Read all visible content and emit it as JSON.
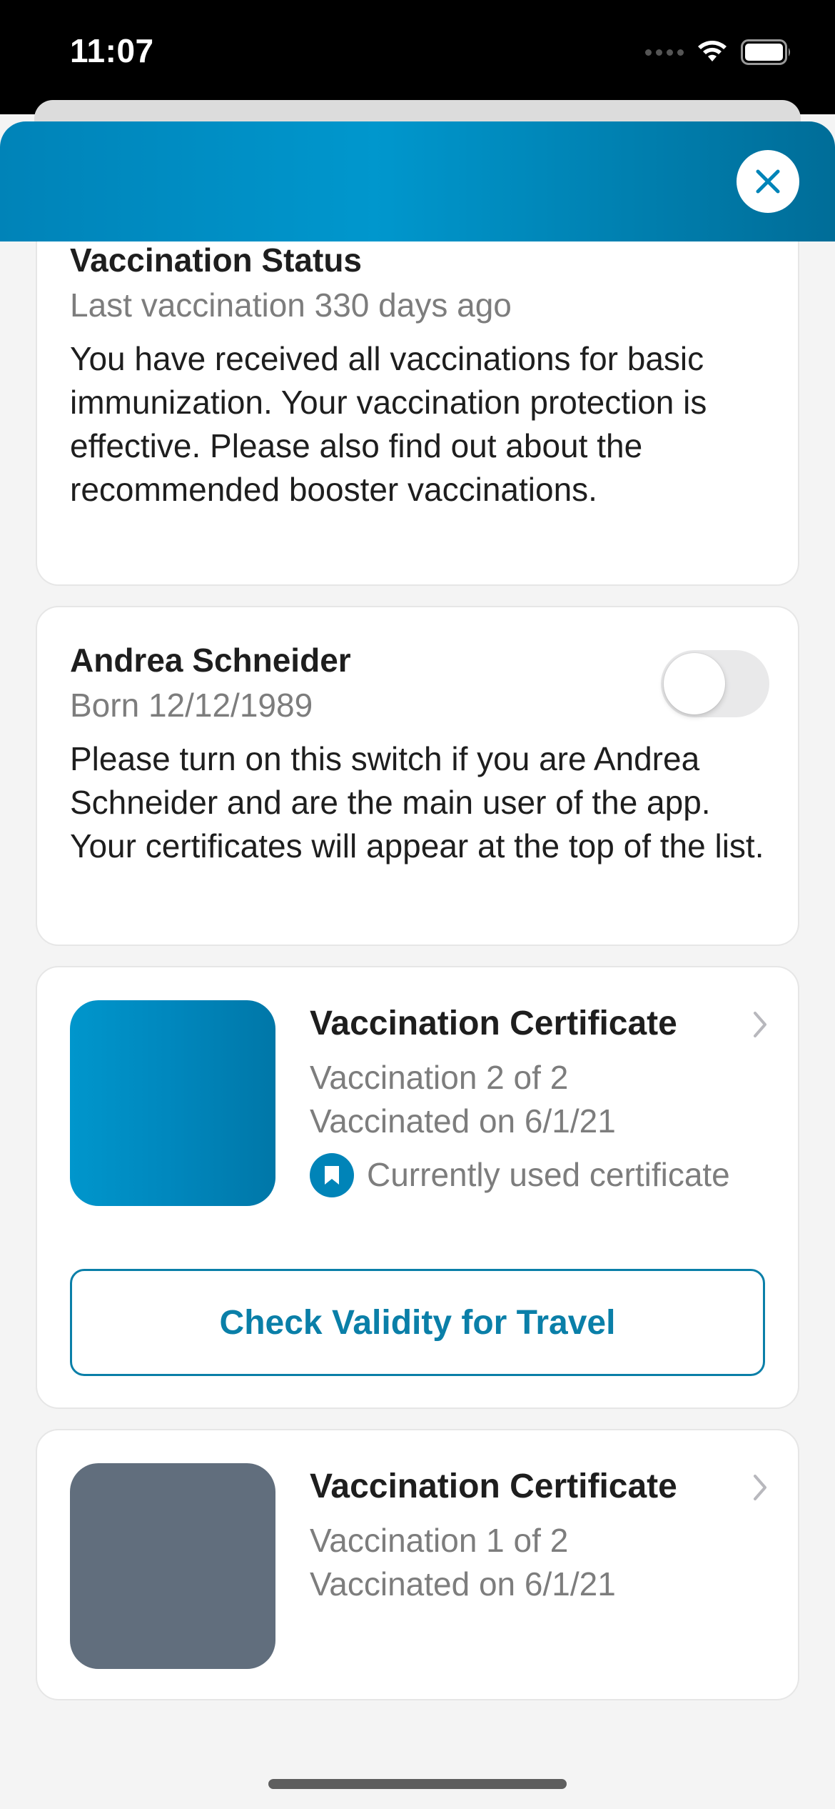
{
  "status_bar": {
    "time": "11:07",
    "icons": [
      "signal-dots-icon",
      "wifi-icon",
      "battery-icon"
    ]
  },
  "header": {
    "close_icon": "close-icon",
    "accent_color": "#0090c4"
  },
  "vaccination_status": {
    "title": "Vaccination Status",
    "subtitle": "Last vaccination 330 days ago",
    "body": "You have received all vaccinations for basic immunization. Your vaccination protection is effective. Please also find out about the recommended booster vaccinations."
  },
  "user": {
    "name": "Andrea Schneider",
    "born": "Born 12/12/1989",
    "main_user_toggle": "off",
    "description": "Please turn on this switch if you are Andrea Schneider and are the main user of the app. Your certificates will appear at the top of the list."
  },
  "certificates": [
    {
      "title": "Vaccination Certificate",
      "dose": "Vaccination 2 of 2",
      "date": "Vaccinated on 6/1/21",
      "status": "Currently used certificate",
      "status_icon": "bookmark-icon",
      "thumb_color": "#0090c6",
      "action": "Check Validity for Travel"
    },
    {
      "title": "Vaccination Certificate",
      "dose": "Vaccination 1 of 2",
      "date": "Vaccinated on 6/1/21",
      "thumb_color": "#616e7d"
    }
  ]
}
